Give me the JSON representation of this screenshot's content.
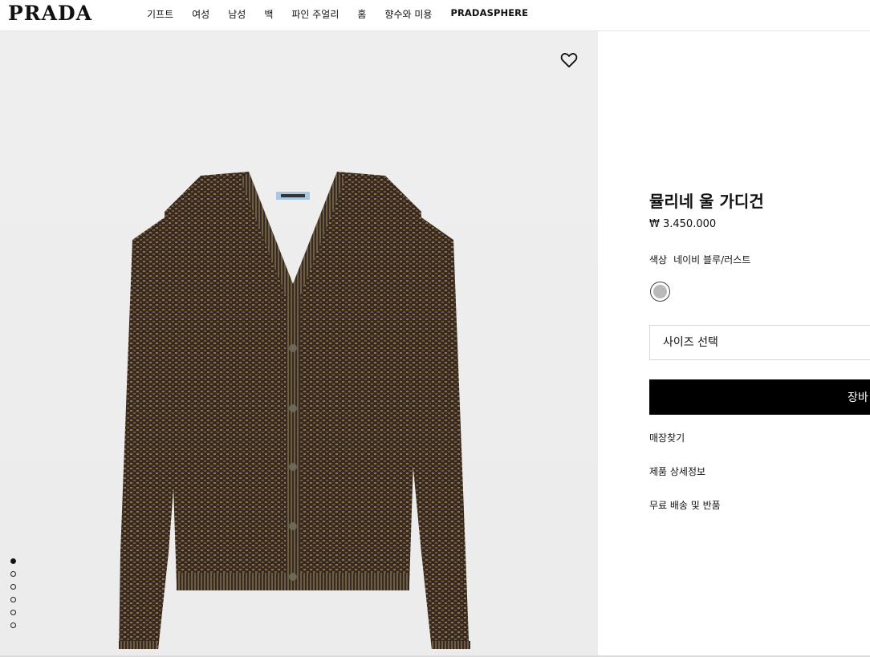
{
  "header": {
    "logo": "PRADA",
    "nav": [
      "기프트",
      "여성",
      "남성",
      "백",
      "파인 주얼리",
      "홈",
      "향수와 미용",
      "PRADASPHERE"
    ]
  },
  "gallery": {
    "slide_count": 6,
    "active_slide": 1
  },
  "product": {
    "title": "뮬리네 울 가디건",
    "price": "₩ 3.450.000",
    "color_label": "색상",
    "color_value": "네이비 블루/러스트",
    "size_placeholder": "사이즈 선택",
    "cart_label": "장바",
    "links": [
      "매장찾기",
      "제품 상세정보",
      "무료 배송 및 반품"
    ]
  },
  "colors": {
    "swatch": "#b9b9b9",
    "button_bg": "#000000"
  }
}
